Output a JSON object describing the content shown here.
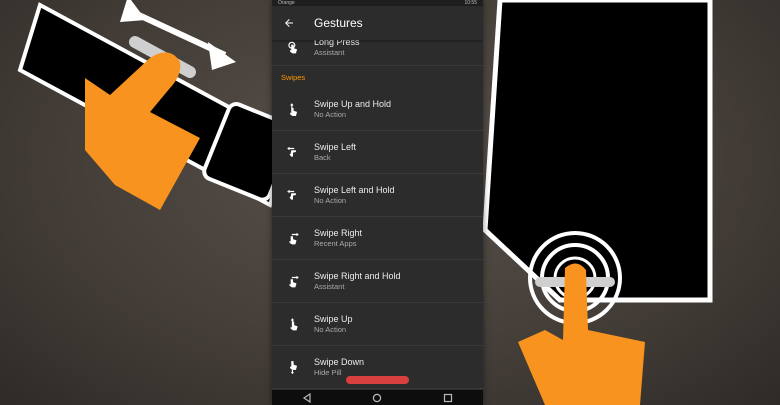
{
  "status_bar": {
    "left": "Orange",
    "right": "10:55"
  },
  "app_bar": {
    "title": "Gestures",
    "back_icon": "arrow-back-icon"
  },
  "items_top": [
    {
      "title": "Long Press",
      "subtitle": "Assistant",
      "icon": "long-press-icon"
    }
  ],
  "section_label": "Swipes",
  "items": [
    {
      "title": "Swipe Up and Hold",
      "subtitle": "No Action",
      "icon": "swipe-up-hold-icon"
    },
    {
      "title": "Swipe Left",
      "subtitle": "Back",
      "icon": "swipe-left-icon"
    },
    {
      "title": "Swipe Left and Hold",
      "subtitle": "No Action",
      "icon": "swipe-left-hold-icon"
    },
    {
      "title": "Swipe Right",
      "subtitle": "Recent Apps",
      "icon": "swipe-right-icon"
    },
    {
      "title": "Swipe Right and Hold",
      "subtitle": "Assistant",
      "icon": "swipe-right-hold-icon"
    },
    {
      "title": "Swipe Up",
      "subtitle": "No Action",
      "icon": "swipe-up-icon"
    },
    {
      "title": "Swipe Down",
      "subtitle": "Hide Pill",
      "icon": "swipe-down-icon"
    }
  ],
  "colors": {
    "accent": "#ff9800",
    "pill": "#d84040",
    "surface": "#2c2c2c",
    "hand_orange": "#f7931e"
  }
}
